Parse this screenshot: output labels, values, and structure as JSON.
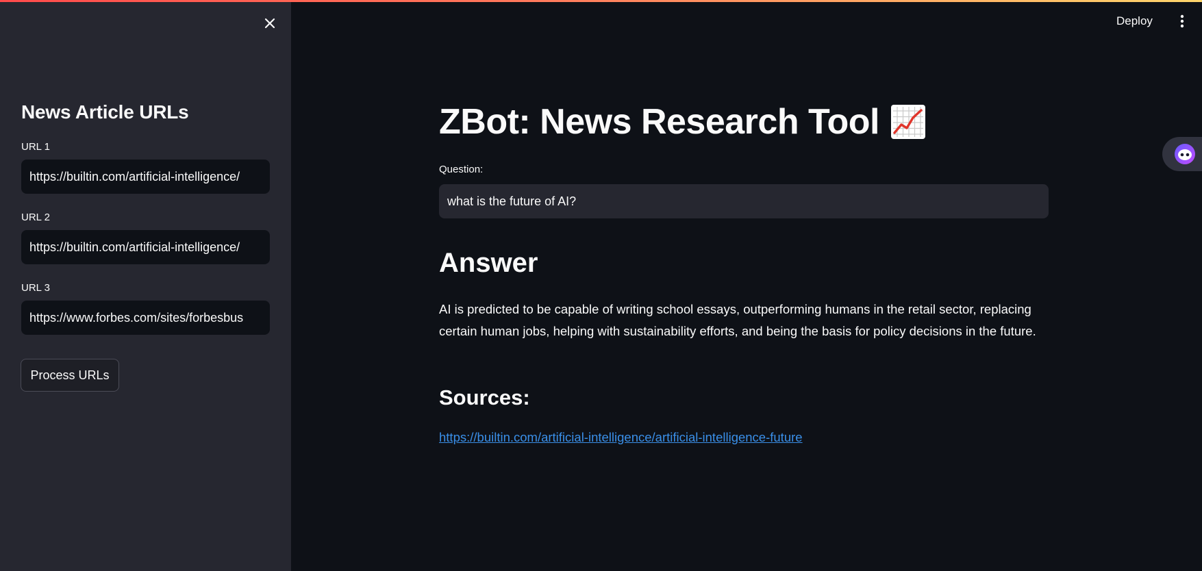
{
  "header": {
    "deploy_label": "Deploy",
    "menu_icon": "kebab-menu-icon"
  },
  "sidebar": {
    "close_icon": "close-icon",
    "heading": "News Article URLs",
    "url_fields": [
      {
        "label": "URL 1",
        "value": "https://builtin.com/artificial-intelligence/"
      },
      {
        "label": "URL 2",
        "value": "https://builtin.com/artificial-intelligence/"
      },
      {
        "label": "URL 3",
        "value": "https://www.forbes.com/sites/forbesbus"
      }
    ],
    "process_button_label": "Process URLs"
  },
  "main": {
    "title": "ZBot: News Research Tool",
    "title_icon": "chart-increasing-icon",
    "question_label": "Question:",
    "question_value": "what is the future of AI?",
    "answer_heading": "Answer",
    "answer_text": "AI is predicted to be capable of writing school essays, outperforming humans in the retail sector, replacing certain human jobs, helping with sustainability efforts, and being the basis for policy decisions in the future.",
    "sources_heading": "Sources:",
    "source_link": "https://builtin.com/artificial-intelligence/artificial-intelligence-future"
  },
  "colors": {
    "app_background": "#0e1117",
    "sidebar_background": "#262730",
    "link": "#3a8fe8",
    "accent_gradient_start": "#ff4b4b",
    "accent_gradient_end": "#fdd56b"
  }
}
